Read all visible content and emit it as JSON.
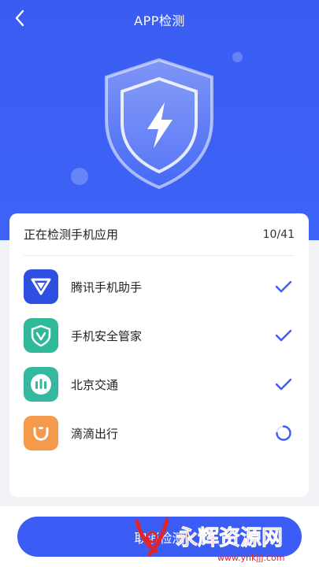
{
  "header": {
    "title": "APP检测",
    "back_icon": "chevron-left-icon"
  },
  "card": {
    "title": "正在检测手机应用",
    "progress_text": "10/41",
    "progress": {
      "current": 10,
      "total": 41
    }
  },
  "apps": [
    {
      "name": "腾讯手机助手",
      "icon": "tencent-assistant-icon",
      "status": "done"
    },
    {
      "name": "手机安全管家",
      "icon": "security-shield-icon",
      "status": "done"
    },
    {
      "name": "北京交通",
      "icon": "beijing-transit-icon",
      "status": "done"
    },
    {
      "name": "滴滴出行",
      "icon": "didi-icon",
      "status": "scanning"
    }
  ],
  "footer": {
    "button_label": "取消检测"
  },
  "watermark": {
    "text": "永辉资源网",
    "url": "www.yhkjjj.com"
  },
  "colors": {
    "primary": "#3b5df5",
    "tencent": "#2f4fe0",
    "security": "#2fb89a",
    "transit": "#34b8a0",
    "didi": "#f59a4a",
    "watermark": "#e0252a"
  }
}
